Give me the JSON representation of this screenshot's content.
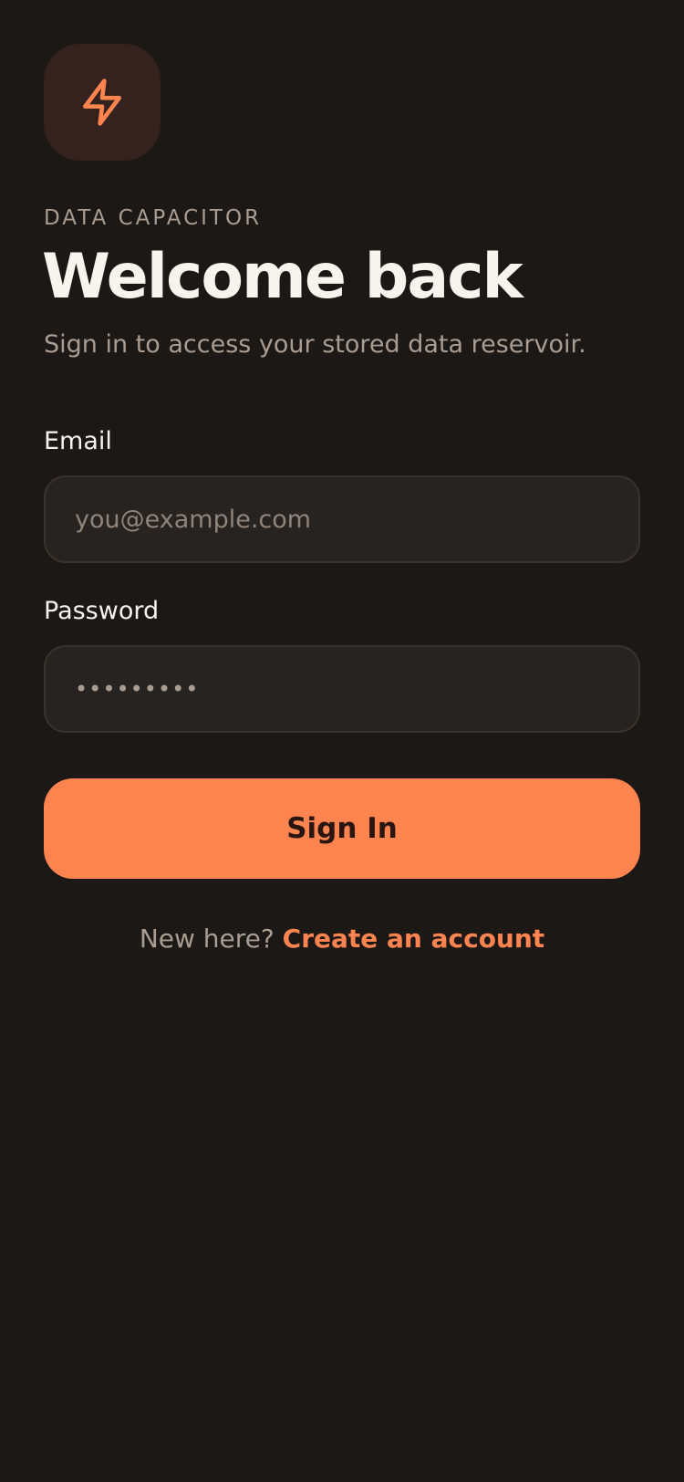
{
  "brand": {
    "icon": "lightning-bolt-icon",
    "eyebrow": "DATA CAPACITOR"
  },
  "header": {
    "title": "Welcome back",
    "subtitle": "Sign in to access your stored data reservoir."
  },
  "form": {
    "email_label": "Email",
    "email_placeholder": "you@example.com",
    "email_value": "",
    "password_label": "Password",
    "password_value": "•••••••••",
    "submit_label": "Sign In"
  },
  "footer": {
    "prompt": "New here?",
    "link_label": "Create an account"
  },
  "colors": {
    "background": "#1c1816",
    "accent": "#ff8450",
    "logo_tile": "#33221d",
    "field_background": "#272320",
    "muted_text": "#a99c91"
  }
}
